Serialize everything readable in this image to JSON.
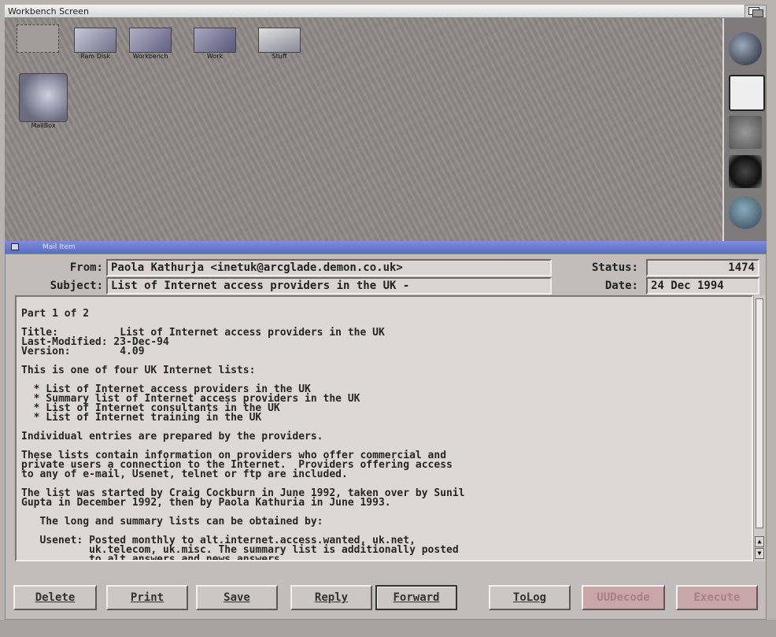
{
  "screen": {
    "title": "Workbench Screen"
  },
  "desktop": {
    "icons": [
      {
        "label": "",
        "icon": "blank-volume-icon"
      },
      {
        "label": "Ram Disk",
        "icon": "ram-disk-icon"
      },
      {
        "label": "Workbench",
        "icon": "workbench-disk-icon"
      },
      {
        "label": "Work",
        "icon": "work-disk-icon"
      },
      {
        "label": "Stuff",
        "icon": "stuff-drawer-icon"
      },
      {
        "label": "MailBox",
        "icon": "mailbox-icon"
      }
    ],
    "dock": [
      "globe-icon",
      "audio-app-icon",
      "network-icon",
      "gear-icon",
      "robot-icon"
    ]
  },
  "window": {
    "title": "Mail Item"
  },
  "header": {
    "from_label": "From:",
    "from_value": "Paola Kathurja <inetuk@arcglade.demon.co.uk>",
    "subject_label": "Subject:",
    "subject_value": "List of Internet access providers in the UK -",
    "status_label": "Status:",
    "status_value": "1474",
    "date_label": "Date:",
    "date_value": "24 Dec 1994"
  },
  "message": {
    "body": "Part 1 of 2\n\nTitle:          List of Internet access providers in the UK\nLast-Modified: 23-Dec-94\nVersion:        4.09\n\nThis is one of four UK Internet lists:\n\n  * List of Internet access providers in the UK\n  * Summary list of Internet access providers in the UK\n  * List of Internet consultants in the UK\n  * List of Internet training in the UK\n\nIndividual entries are prepared by the providers.\n\nThese lists contain information on providers who offer commercial and\nprivate users a connection to the Internet.  Providers offering access\nto any of e-mail, Usenet, telnet or ftp are included.\n\nThe list was started by Craig Cockburn in June 1992, taken over by Sunil\nGupta in December 1992, then by Paola Kathuria in June 1993.\n\n   The long and summary lists can be obtained by:\n\n   Usenet: Posted monthly to alt.internet.access.wanted, uk.net,\n           uk.telecom, uk.misc. The summary list is additionally posted\n           to alt.answers and news.answers"
  },
  "buttons": {
    "delete": "Delete",
    "print": "Print",
    "save": "Save",
    "reply": "Reply",
    "forward": "Forward",
    "tolog": "ToLog",
    "disabled1": "UUDecode",
    "disabled2": "Execute"
  },
  "colors": {
    "window_title_bar": "#5a6cc4",
    "window_body": "#c2bcbc",
    "disabled_button": "#c9a6a8"
  }
}
